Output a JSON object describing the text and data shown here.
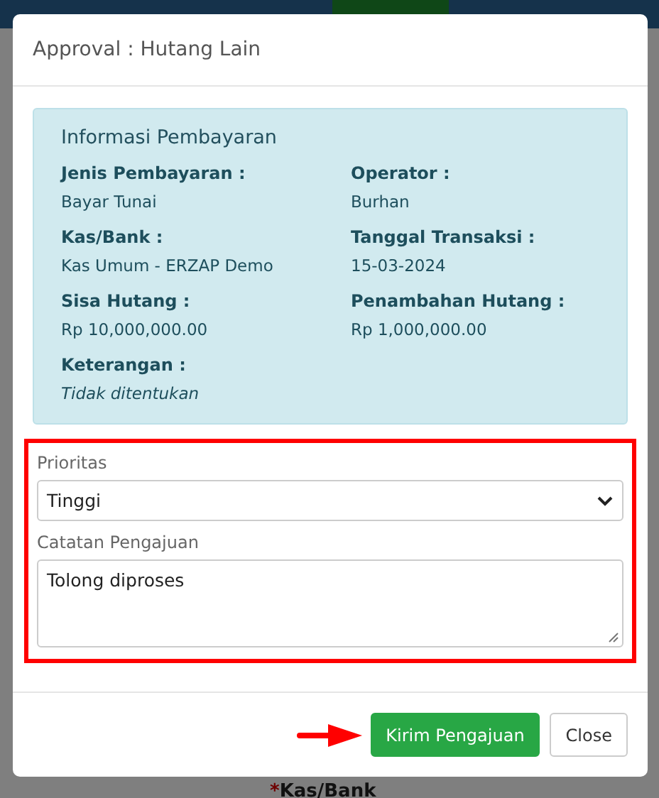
{
  "background_form": {
    "label": "Kas/Bank",
    "required_mark": "*"
  },
  "modal": {
    "title": "Approval : Hutang Lain",
    "info_panel": {
      "heading": "Informasi Pembayaran",
      "fields": [
        {
          "label": "Jenis Pembayaran :",
          "value": "Bayar Tunai",
          "italic": false
        },
        {
          "label": "Operator :",
          "value": "Burhan",
          "italic": false
        },
        {
          "label": "Kas/Bank :",
          "value": "Kas Umum - ERZAP Demo",
          "italic": false
        },
        {
          "label": "Tanggal Transaksi :",
          "value": "15-03-2024",
          "italic": false
        },
        {
          "label": "Sisa Hutang :",
          "value": "Rp 10,000,000.00",
          "italic": false
        },
        {
          "label": "Penambahan Hutang :",
          "value": "Rp 1,000,000.00",
          "italic": false
        },
        {
          "label": "Keterangan :",
          "value": "Tidak ditentukan",
          "italic": true
        }
      ]
    },
    "form": {
      "highlighted": true,
      "priority": {
        "label": "Prioritas",
        "value": "Tinggi"
      },
      "note": {
        "label": "Catatan Pengajuan",
        "value": "Tolong diproses"
      }
    },
    "footer": {
      "arrow_pointer": true,
      "buttons": [
        {
          "label": "Kirim Pengajuan",
          "kind": "primary"
        },
        {
          "label": "Close",
          "kind": "secondary"
        }
      ]
    }
  }
}
